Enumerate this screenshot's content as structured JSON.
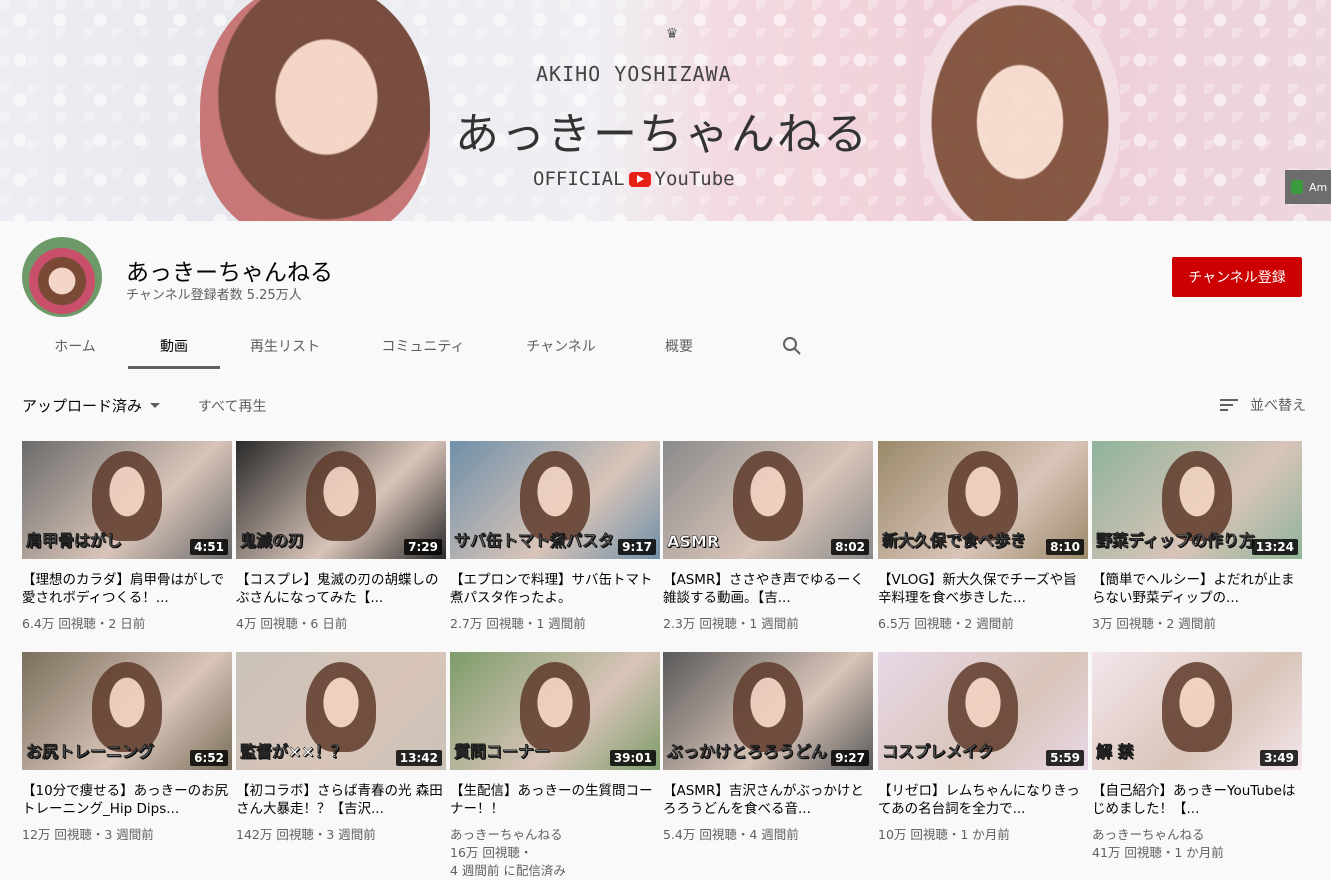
{
  "banner": {
    "title_en": "AKIHO YOSHIZAWA",
    "title_jp": "あっきーちゃんねる",
    "official_left": "OFFICIAL",
    "official_right": "YouTube",
    "corner_text": "Am"
  },
  "channel": {
    "name": "あっきーちゃんねる",
    "subscribers": "チャンネル登録者数 5.25万人",
    "subscribe_label": "チャンネル登録"
  },
  "tabs": [
    {
      "label": "ホーム"
    },
    {
      "label": "動画"
    },
    {
      "label": "再生リスト"
    },
    {
      "label": "コミュニティ"
    },
    {
      "label": "チャンネル"
    },
    {
      "label": "概要"
    }
  ],
  "toolbar": {
    "filter_label": "アップロード済み",
    "play_all": "すべて再生",
    "sort_label": "並べ替え"
  },
  "videos": [
    {
      "thumb_text": "肩甲骨はがし",
      "duration": "4:51",
      "title": "【理想のカラダ】肩甲骨はがしで愛されボディつくる！...",
      "meta1": "6.4万 回視聴・2 日前",
      "meta2": "",
      "meta3": "",
      "bg": "#6b6b6b"
    },
    {
      "thumb_text": "鬼滅の刃",
      "duration": "7:29",
      "title": "【コスプレ】鬼滅の刃の胡蝶しのぶさんになってみた【...",
      "meta1": "4万 回視聴・6 日前",
      "meta2": "",
      "meta3": "",
      "bg": "#2a2a2a"
    },
    {
      "thumb_text": "サバ缶トマト煮パスタ",
      "duration": "9:17",
      "title": "【エプロンで料理】サバ缶トマト煮パスタ作ったよ。",
      "meta1": "2.7万 回視聴・1 週間前",
      "meta2": "",
      "meta3": "",
      "bg": "#6f8fa8"
    },
    {
      "thumb_text": "ASMR",
      "duration": "8:02",
      "title": "【ASMR】ささやき声でゆるーく雑談する動画。【吉...",
      "meta1": "2.3万 回視聴・1 週間前",
      "meta2": "",
      "meta3": "",
      "bg": "#8a8a8a"
    },
    {
      "thumb_text": "新大久保で食べ歩き",
      "duration": "8:10",
      "title": "【VLOG】新大久保でチーズや旨辛料理を食べ歩きした...",
      "meta1": "6.5万 回視聴・2 週間前",
      "meta2": "",
      "meta3": "",
      "bg": "#9a8a6a"
    },
    {
      "thumb_text": "野菜ディップの作り方",
      "duration": "13:24",
      "title": "【簡単でヘルシー】よだれが止まらない野菜ディップの...",
      "meta1": "3万 回視聴・2 週間前",
      "meta2": "",
      "meta3": "",
      "bg": "#8fb39a"
    },
    {
      "thumb_text": "お尻トレーニング",
      "duration": "6:52",
      "title": "【10分で痩せる】あっきーのお尻トレーニング_Hip Dips...",
      "meta1": "12万 回視聴・3 週間前",
      "meta2": "",
      "meta3": "",
      "bg": "#7a6f5c"
    },
    {
      "thumb_text": "監督が××！？",
      "duration": "13:42",
      "title": "【初コラボ】さらば青春の光 森田さん大暴走！？【吉沢...",
      "meta1": "142万 回視聴・3 週間前",
      "meta2": "",
      "meta3": "",
      "bg": "#c9c2b8"
    },
    {
      "thumb_text": "質問コーナー",
      "duration": "39:01",
      "title": "【生配信】あっきーの生質問コーナー！！",
      "meta1": "あっきーちゃんねる",
      "meta2": "16万 回視聴・",
      "meta3": "4 週間前 に配信済み",
      "bg": "#7d9c6a"
    },
    {
      "thumb_text": "ぶっかけとろろうどん",
      "duration": "9:27",
      "title": "【ASMR】吉沢さんがぶっかけとろろうどんを食べる音...",
      "meta1": "5.4万 回視聴・4 週間前",
      "meta2": "",
      "meta3": "",
      "bg": "#5a5a5a"
    },
    {
      "thumb_text": "コスプレメイク",
      "duration": "5:59",
      "title": "【リゼロ】レムちゃんになりきってあの名台詞を全力で...",
      "meta1": "10万 回視聴・1 か月前",
      "meta2": "",
      "meta3": "",
      "bg": "#e8d8e8"
    },
    {
      "thumb_text": "解 禁",
      "duration": "3:49",
      "title": "【自己紹介】あっきーYouTubeはじめました！【...",
      "meta1": "あっきーちゃんねる",
      "meta2": "41万 回視聴・1 か月前",
      "meta3": "",
      "bg": "#f4e6ec"
    }
  ]
}
